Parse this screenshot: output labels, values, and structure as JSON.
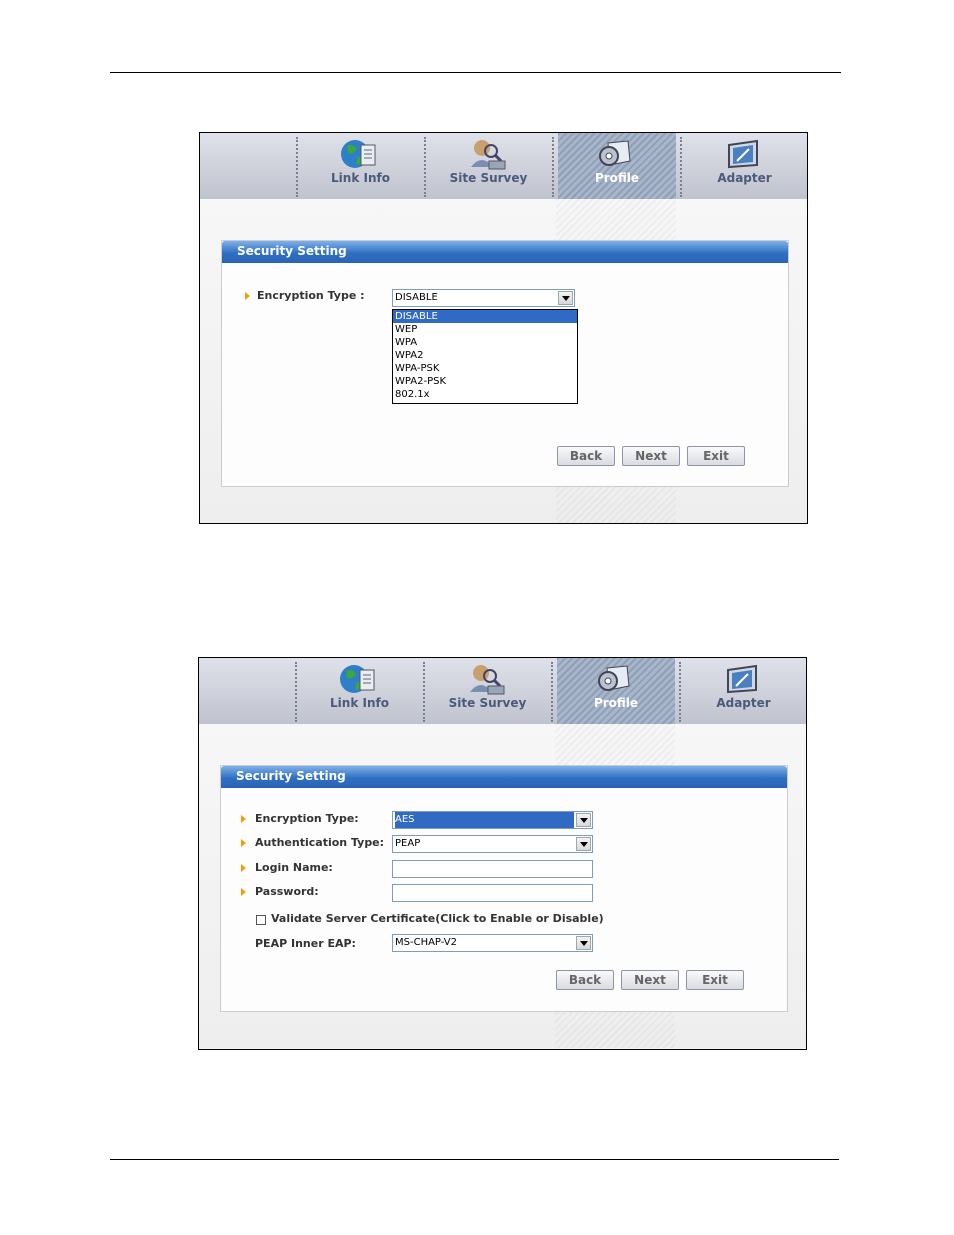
{
  "tabs": [
    {
      "label": "Link Info",
      "icon": "globe-icon"
    },
    {
      "label": "Site Survey",
      "icon": "site-survey-icon"
    },
    {
      "label": "Profile",
      "icon": "profile-gear-icon"
    },
    {
      "label": "Adapter",
      "icon": "adapter-icon"
    }
  ],
  "active_tab": "Profile",
  "screen1": {
    "panel_title": "Security Setting",
    "encryption_label": "Encryption Type :",
    "encryption_value": "DISABLE",
    "dropdown_options": [
      "DISABLE",
      "WEP",
      "WPA",
      "WPA2",
      "WPA-PSK",
      "WPA2-PSK",
      "802.1x"
    ],
    "selected_option": "DISABLE",
    "buttons": {
      "back": "Back",
      "next": "Next",
      "exit": "Exit"
    }
  },
  "screen2": {
    "panel_title": "Security Setting",
    "encryption_label": "Encryption Type:",
    "encryption_value": "AES",
    "auth_label": "Authentication Type:",
    "auth_value": "PEAP",
    "login_label": "Login Name:",
    "login_value": "",
    "password_label": "Password:",
    "password_value": "",
    "validate_label": "Validate Server Certificate(Click to Enable or Disable)",
    "validate_checked": false,
    "inner_eap_label": "PEAP Inner EAP:",
    "inner_eap_value": "MS-CHAP-V2",
    "buttons": {
      "back": "Back",
      "next": "Next",
      "exit": "Exit"
    }
  },
  "colors": {
    "header_blue": "#2f6fc2",
    "selection_blue": "#316ac5",
    "bullet": "#f0a000"
  }
}
